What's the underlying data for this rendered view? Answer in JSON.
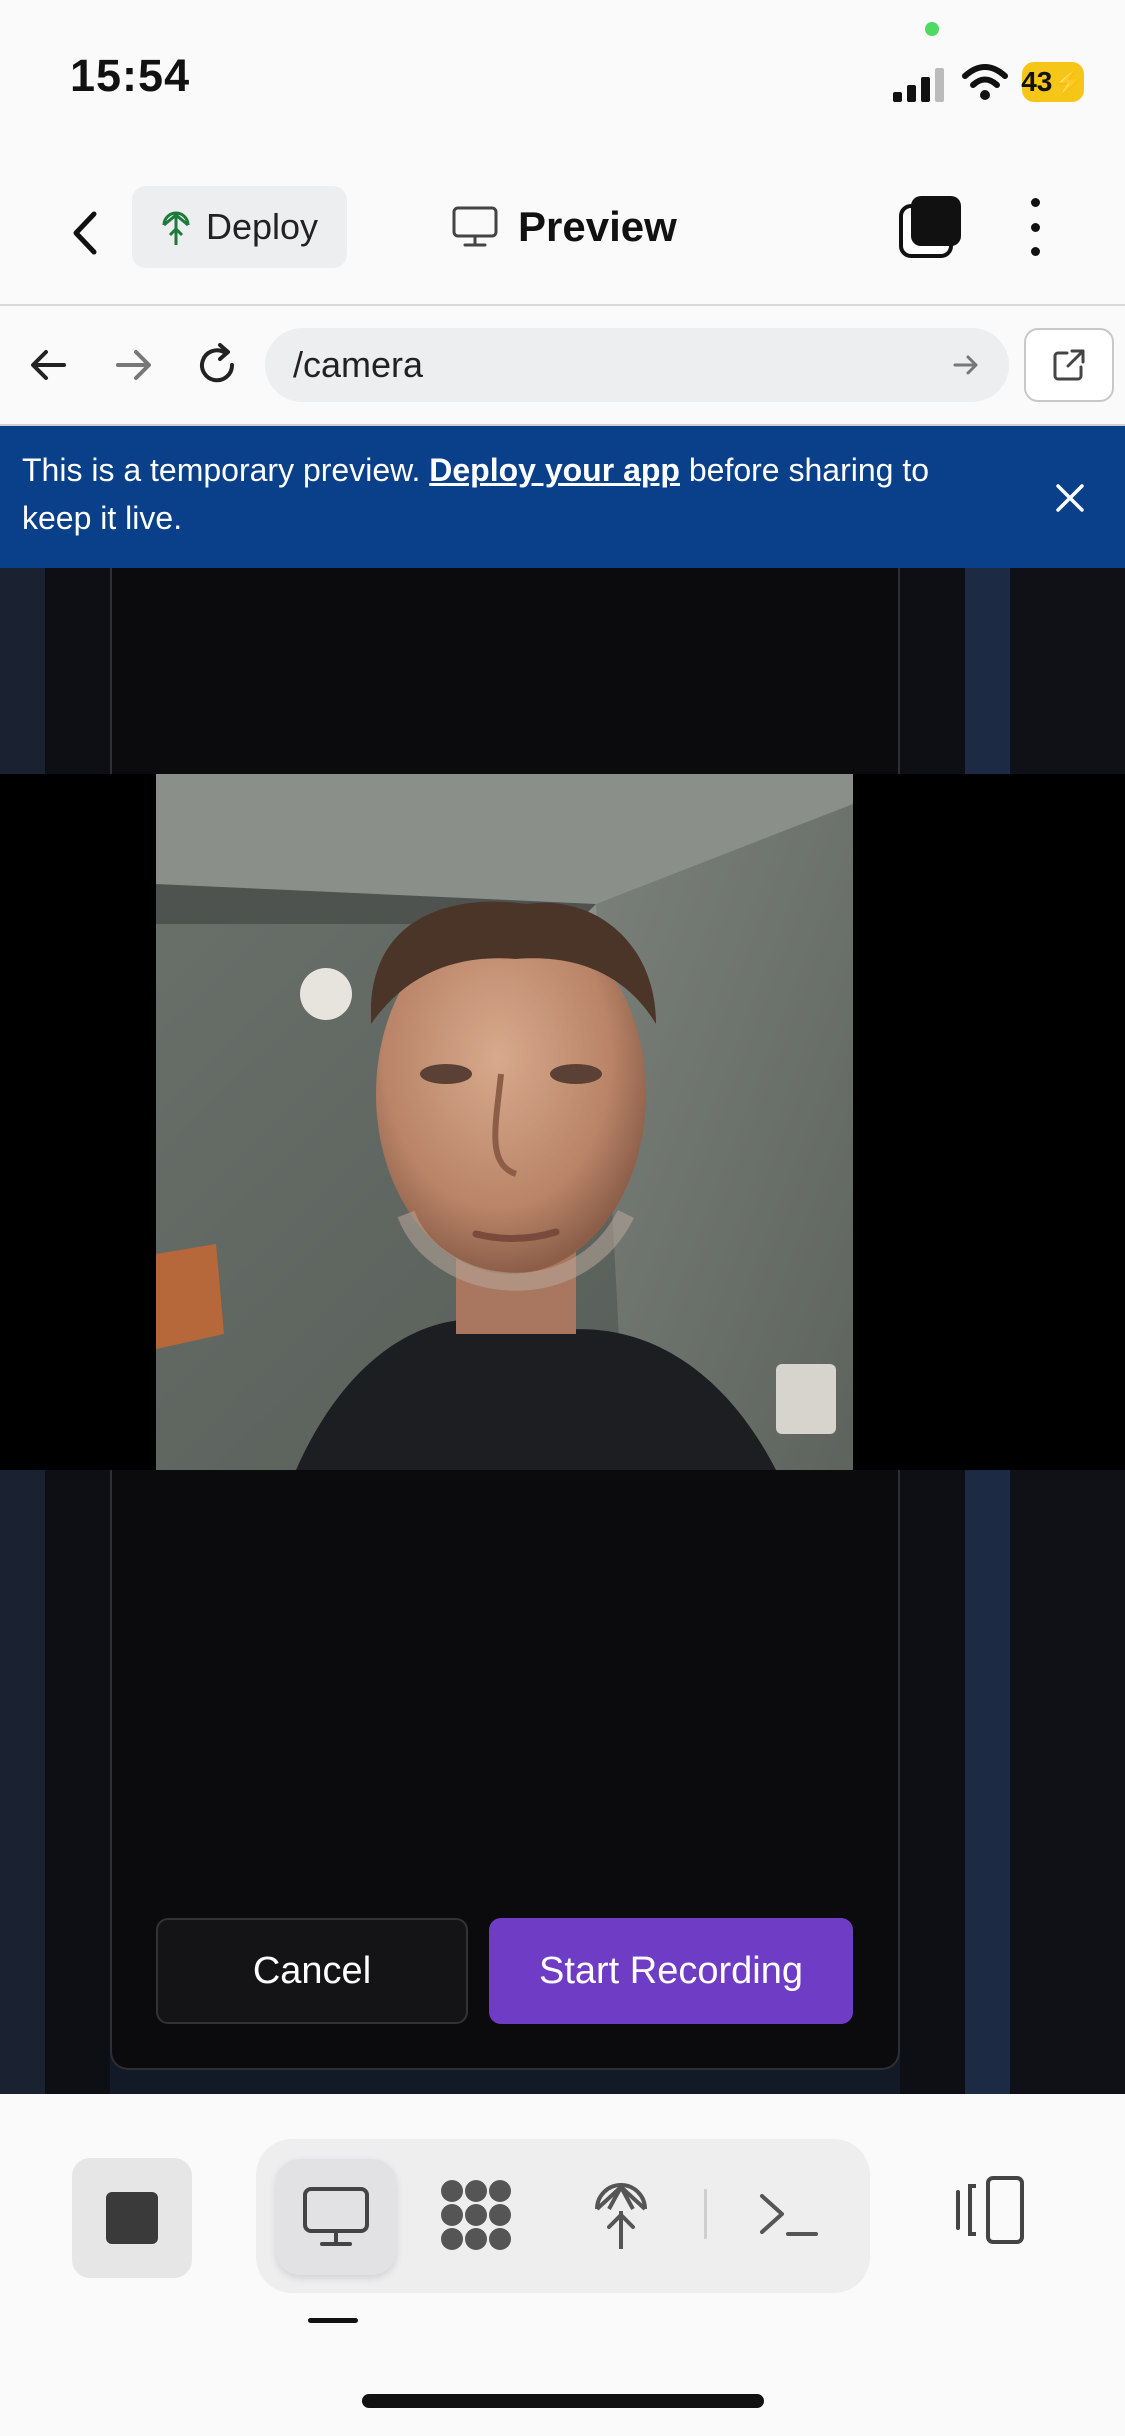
{
  "status_bar": {
    "time": "15:54",
    "battery": "43",
    "icons": [
      "camera-in-use-dot",
      "signal-icon",
      "wifi-icon",
      "battery-charging-icon"
    ]
  },
  "top_bar": {
    "deploy_label": "Deploy",
    "preview_label": "Preview",
    "icons": [
      "chevron-left-icon",
      "deploy-icon",
      "monitor-icon",
      "windows-icon",
      "more-vertical-icon"
    ]
  },
  "url_bar": {
    "url": "/camera",
    "icons": [
      "arrow-left-icon",
      "arrow-right-icon",
      "refresh-icon",
      "go-arrow-icon",
      "external-link-icon"
    ]
  },
  "banner": {
    "text_before": "This is a temporary preview. ",
    "link": "Deploy your app",
    "text_after": " before sharing to keep it live.",
    "bg_color": "#0a3f8a"
  },
  "app": {
    "cancel_label": "Cancel",
    "record_label": "Start Recording",
    "accent_color": "#6f3dc5"
  },
  "bottom_bar": {
    "tools": [
      "stop-icon",
      "desktop-icon",
      "integrations-icon",
      "deploy-icon",
      "terminal-icon",
      "sidebar-toggle-icon"
    ],
    "active_tool": "desktop"
  }
}
